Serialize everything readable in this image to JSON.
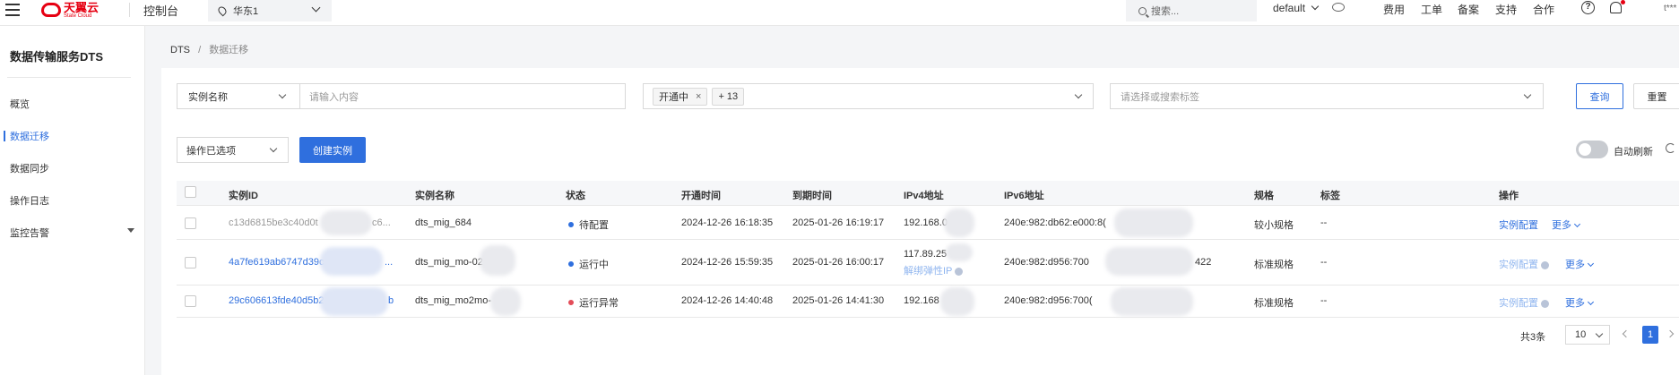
{
  "topbar": {
    "logo_cn": "天翼云",
    "logo_en": "State Cloud",
    "console": "控制台",
    "region": "华东1",
    "search_placeholder": "搜索...",
    "project": "default",
    "nav": [
      "费用",
      "工单",
      "备案",
      "支持",
      "合作"
    ],
    "help": "?",
    "avatar_text": "t***"
  },
  "sidebar": {
    "title": "数据传输服务DTS",
    "items": [
      "概览",
      "数据迁移",
      "数据同步",
      "操作日志",
      "监控告警"
    ]
  },
  "breadcrumb": {
    "root": "DTS",
    "sep": "/",
    "current": "数据迁移"
  },
  "filters": {
    "field_select": "实例名称",
    "input_placeholder": "请输入内容",
    "status_tag": "开通中",
    "status_more": "+ 13",
    "label_placeholder": "请选择或搜索标签",
    "query_button": "查询",
    "reset_button": "重置"
  },
  "toolbar": {
    "bulk_ops": "操作已选项",
    "create_button": "创建实例",
    "auto_refresh": "自动刷新"
  },
  "table": {
    "headers": [
      "实例ID",
      "实例名称",
      "状态",
      "开通时间",
      "到期时间",
      "IPv4地址",
      "IPv6地址",
      "规格",
      "标签",
      "操作"
    ],
    "rows": [
      {
        "id": "c13d6815be3c40d0t",
        "id_tail": "c6...",
        "name": "dts_mig_684",
        "status": "待配置",
        "status_color": "#2f6fde",
        "open_time": "2024-12-26 16:18:35",
        "expire_time": "2025-01-26 16:19:17",
        "ipv4": "192.168.0",
        "ipv4_extra": "",
        "ipv6": "240e:982:db62:e000:8(",
        "ipv6_tail": "",
        "spec": "较小规格",
        "tags": "--",
        "action": "实例配置",
        "more": "更多"
      },
      {
        "id": "4a7fe619ab6747d39c2",
        "id_tail": "...",
        "name": "dts_mig_mo-02",
        "status": "运行中",
        "status_color": "#2f6fde",
        "open_time": "2024-12-26 15:59:35",
        "expire_time": "2025-01-26 16:00:17",
        "ipv4": "117.89.25",
        "ipv4_extra": "解绑弹性IP",
        "ipv6": "240e:982:d956:700",
        "ipv6_tail": "422",
        "spec": "标准规格",
        "tags": "--",
        "action": "实例配置",
        "more": "更多"
      },
      {
        "id": "29c606613fde40d5b2",
        "id_tail": "b",
        "name": "dts_mig_mo2mo-",
        "status": "运行异常",
        "status_color": "#e34d59",
        "open_time": "2024-12-26 14:40:48",
        "expire_time": "2025-01-26 14:41:30",
        "ipv4": "192.168",
        "ipv4_extra": "",
        "ipv6": "240e:982:d956:700(",
        "ipv6_tail": "",
        "spec": "标准规格",
        "tags": "--",
        "action": "实例配置",
        "more": "更多"
      }
    ]
  },
  "pager": {
    "total": "共3条",
    "page_size": "10",
    "current_page": "1"
  }
}
